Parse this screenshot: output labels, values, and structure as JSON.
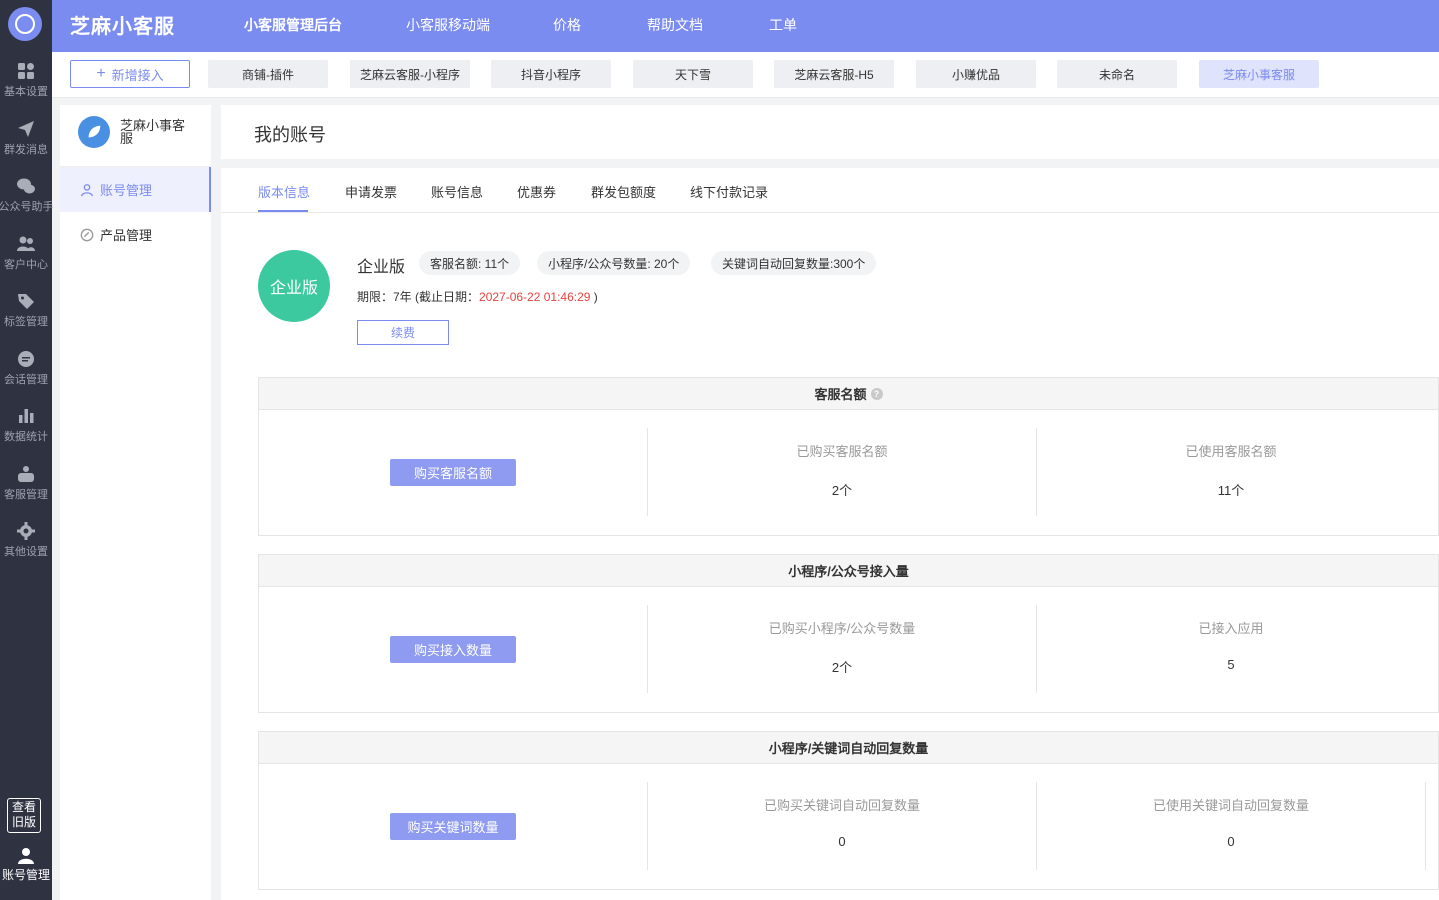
{
  "rail": {
    "items": [
      {
        "label": "基本设置",
        "icon": "grid-icon"
      },
      {
        "label": "群发消息",
        "icon": "send-icon"
      },
      {
        "label": "公众号助手",
        "icon": "wechat-icon"
      },
      {
        "label": "客户中心",
        "icon": "users-icon"
      },
      {
        "label": "标签管理",
        "icon": "tag-icon"
      },
      {
        "label": "会话管理",
        "icon": "chat-icon"
      },
      {
        "label": "数据统计",
        "icon": "bar-chart-icon"
      },
      {
        "label": "客服管理",
        "icon": "service-icon"
      },
      {
        "label": "其他设置",
        "icon": "gear-icon"
      }
    ],
    "old_version": "查看旧版",
    "account": "账号管理"
  },
  "header": {
    "brand": "芝麻小客服",
    "nav": [
      "小客服管理后台",
      "小客服移动端",
      "价格",
      "帮助文档",
      "工单"
    ]
  },
  "appbar": {
    "add_label": "新增接入",
    "apps": [
      "商铺-插件",
      "芝麻云客服-小程序",
      "抖音小程序",
      "天下雪",
      "芝麻云客服-H5",
      "小赚优品",
      "未命名",
      "芝麻小事客服"
    ]
  },
  "side": {
    "name": "芝麻小事客服",
    "items": [
      "账号管理",
      "产品管理"
    ]
  },
  "page": {
    "title": "我的账号",
    "tabs": [
      "版本信息",
      "申请发票",
      "账号信息",
      "优惠券",
      "群发包额度",
      "线下付款记录"
    ],
    "version": {
      "badge": "企业版",
      "name": "企业版",
      "pills": [
        "客服名额: 11个",
        "小程序/公众号数量: 20个",
        "关键词自动回复数量:300个"
      ],
      "period_prefix": "期限：7年  (截止日期：",
      "period_date": "2027-06-22 01:46:29",
      "period_suffix": " )",
      "renew": "续费"
    },
    "sections": [
      {
        "title": "客服名额",
        "button": "购买客服名额",
        "stats": [
          {
            "label": "已购买客服名额",
            "value": "2个"
          },
          {
            "label": "已使用客服名额",
            "value": "11个"
          }
        ]
      },
      {
        "title": "小程序/公众号接入量",
        "button": "购买接入数量",
        "stats": [
          {
            "label": "已购买小程序/公众号数量",
            "value": "2个"
          },
          {
            "label": "已接入应用",
            "value": "5"
          }
        ]
      },
      {
        "title": "小程序/关键词自动回复数量",
        "button": "购买关键词数量",
        "stats": [
          {
            "label": "已购买关键词自动回复数量",
            "value": "0"
          },
          {
            "label": "已使用关键词自动回复数量",
            "value": "0"
          }
        ]
      }
    ]
  }
}
